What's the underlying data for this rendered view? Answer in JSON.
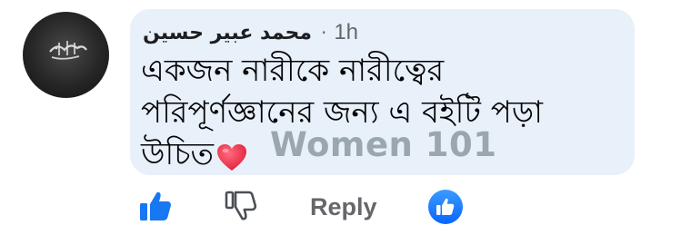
{
  "comment": {
    "author": "محمد عبير حسين",
    "separator": "·",
    "time": "1h",
    "text_lines": [
      "একজন নারীকে নারীত্বের",
      "পরিপূর্ণজ্ঞানের জন্য এ বইটি পড়া",
      "উচিত"
    ],
    "emoji": "heart-icon",
    "watermark": "Women 101"
  },
  "actions": {
    "like_icon": "thumbs-up-icon",
    "dislike_icon": "thumbs-down-icon",
    "reply_label": "Reply",
    "reaction_icon": "like-reaction-icon"
  },
  "colors": {
    "bubble": "#e8f0fa",
    "like_blue": "#1877f2",
    "muted": "#65676b",
    "heart": "#e8334a",
    "watermark": "#9ba7ae"
  }
}
